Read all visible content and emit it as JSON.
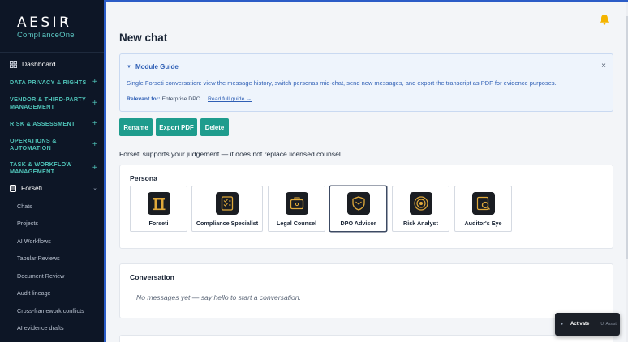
{
  "sidebar": {
    "logo": {
      "main": "AESIR",
      "sub": "ComplianceOne"
    },
    "dashboard": "Dashboard",
    "sections": [
      {
        "l1": "DATA PRIVACY & RIGHTS",
        "l2": ""
      },
      {
        "l1": "VENDOR & THIRD-PARTY",
        "l2": "MANAGEMENT"
      },
      {
        "l1": "RISK & ASSESSMENT",
        "l2": ""
      },
      {
        "l1": "OPERATIONS &",
        "l2": "AUTOMATION"
      },
      {
        "l1": "TASK & WORKFLOW",
        "l2": "MANAGEMENT"
      }
    ],
    "forseti": "Forseti",
    "sub_items": [
      "Chats",
      "Projects",
      "AI Workflows",
      "Tabular Reviews",
      "Document Review",
      "Audit lineage",
      "Cross-framework conflicts",
      "AI evidence drafts"
    ]
  },
  "page": {
    "title": "New chat"
  },
  "guide": {
    "title": "Module Guide",
    "text": "Single Forseti conversation: view the message history, switch personas mid-chat, send new messages, and export the transcript as PDF for evidence purposes.",
    "relevant_label": "Relevant for:",
    "relevant_value": "Enterprise DPO",
    "link": "Read full guide →",
    "close": "×"
  },
  "actions": {
    "rename": "Rename",
    "export": "Export PDF",
    "delete": "Delete"
  },
  "notice": "Forseti supports your judgement — it does not replace licensed counsel.",
  "persona": {
    "title": "Persona",
    "items": [
      {
        "label": "Forseti",
        "icon": "pillar-gate-icon"
      },
      {
        "label": "Compliance Specialist",
        "icon": "checklist-icon"
      },
      {
        "label": "Legal Counsel",
        "icon": "briefcase-icon"
      },
      {
        "label": "DPO Advisor",
        "icon": "shield-icon",
        "selected": true
      },
      {
        "label": "Risk Analyst",
        "icon": "target-icon"
      },
      {
        "label": "Auditor's Eye",
        "icon": "magnifier-icon"
      }
    ]
  },
  "conversation": {
    "title": "Conversation",
    "empty": "No messages yet — say hello to start a conversation."
  },
  "assist": {
    "dot": "●",
    "activate": "Activate",
    "brand": "UI Assist"
  },
  "colors": {
    "sidebar": "#0d1626",
    "accent": "#1e9c8d",
    "teal_text": "#4fc3b8",
    "link": "#2f5fb5"
  }
}
